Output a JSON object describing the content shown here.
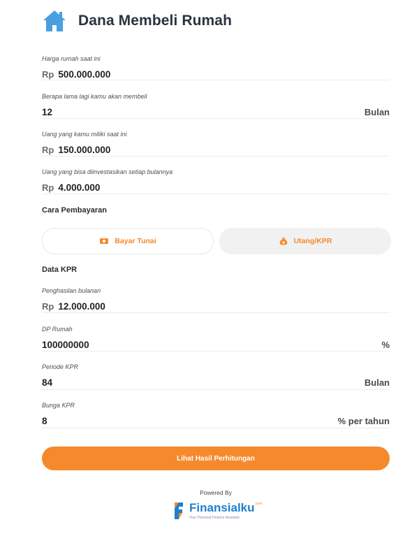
{
  "header": {
    "title": "Dana Membeli Rumah"
  },
  "fields": {
    "harga": {
      "label": "Harga rumah saat ini",
      "prefix": "Rp",
      "value": "500.000.000"
    },
    "lama": {
      "label": "Berapa lama lagi kamu akan membeli",
      "value": "12",
      "suffix": "Bulan"
    },
    "uang": {
      "label": "Uang yang kamu miliki saat ini",
      "prefix": "Rp",
      "value": "150.000.000"
    },
    "investasi": {
      "label": "Uang yang bisa diinvestasikan setiap bulannya",
      "prefix": "Rp",
      "value": "4.000.000"
    }
  },
  "payment": {
    "title": "Cara Pembayaran",
    "cash_label": "Bayar Tunai",
    "kpr_label": "Utang/KPR",
    "selected": "kpr"
  },
  "kpr": {
    "title": "Data KPR",
    "penghasilan": {
      "label": "Penghasilan bulanan",
      "prefix": "Rp",
      "value": "12.000.000"
    },
    "dp": {
      "label": "DP Rumah",
      "value": "100000000",
      "suffix": "%"
    },
    "periode": {
      "label": "Periode KPR",
      "value": "84",
      "suffix": "Bulan"
    },
    "bunga": {
      "label": "Bunga KPR",
      "value": "8",
      "suffix": "% per tahun"
    }
  },
  "cta_label": "Lihat Hasil Perhitungan",
  "footer": {
    "powered": "Powered By",
    "brand": "Finansialku",
    "brand_suffix": ".com",
    "tagline": "Your Personal Finance Assistant"
  },
  "colors": {
    "accent": "#f58a2c",
    "brand_blue": "#1e7fd0",
    "house_icon": "#4a9fe0"
  },
  "icons": [
    "house-icon",
    "cash-icon",
    "money-bag-icon",
    "finansialku-logo-icon"
  ]
}
